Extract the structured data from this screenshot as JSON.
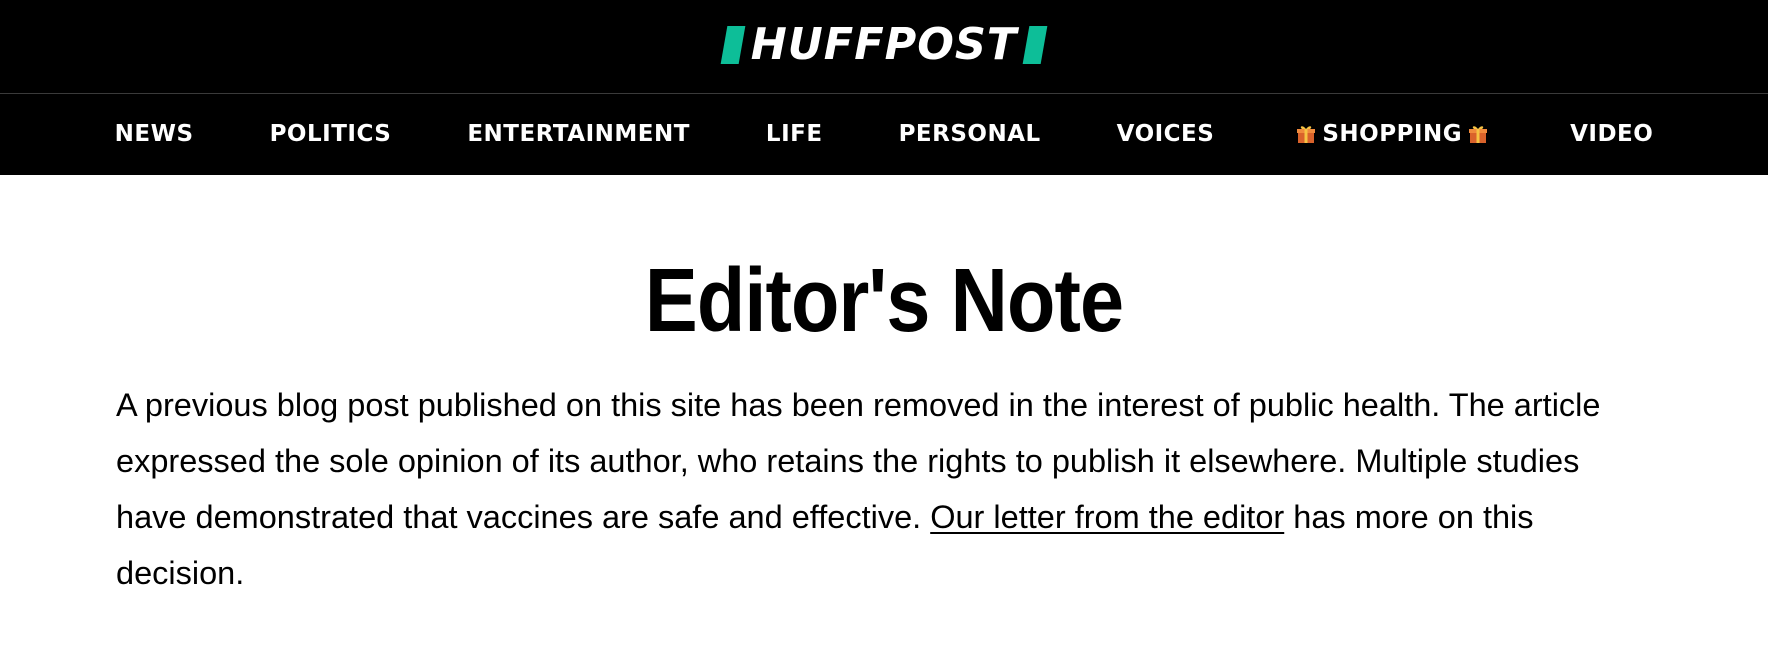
{
  "header": {
    "logo_text": "HUFFPOST",
    "brand_color": "#0dbe98",
    "background_color": "#000000"
  },
  "nav": {
    "items": [
      {
        "label": "NEWS"
      },
      {
        "label": "POLITICS"
      },
      {
        "label": "ENTERTAINMENT"
      },
      {
        "label": "LIFE"
      },
      {
        "label": "PERSONAL"
      },
      {
        "label": "VOICES"
      },
      {
        "label": "SHOPPING",
        "icons": [
          "gift-icon",
          "gift-icon"
        ]
      },
      {
        "label": "VIDEO"
      }
    ]
  },
  "main": {
    "title": "Editor's Note",
    "paragraph_before_link": "A previous blog post published on this site has been removed in the interest of public health. The article expressed the sole opinion of its author, who retains the rights to publish it elsewhere. Multiple studies have demonstrated that vaccines are safe and effective. ",
    "link_text": "Our letter from the editor",
    "paragraph_after_link": " has more on this decision."
  }
}
